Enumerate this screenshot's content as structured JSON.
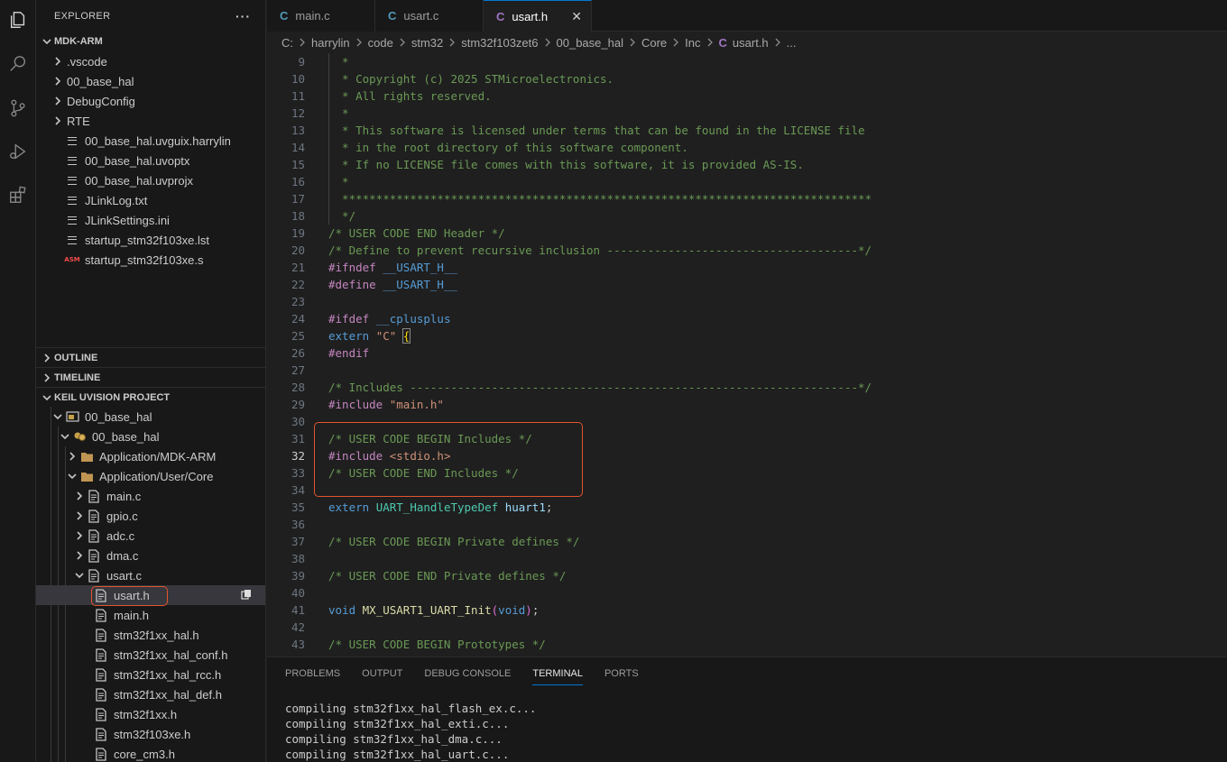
{
  "activity_bar": {
    "icons": [
      "explorer-icon",
      "search-icon",
      "source-control-icon",
      "run-debug-icon",
      "extensions-icon"
    ]
  },
  "explorer": {
    "title": "EXPLORER",
    "more_actions": "···",
    "root_folder": "MDK-ARM",
    "items": [
      ".vscode",
      "00_base_hal",
      "DebugConfig",
      "RTE",
      "00_base_hal.uvguix.harrylin",
      "00_base_hal.uvoptx",
      "00_base_hal.uvprojx",
      "JLinkLog.txt",
      "JLinkSettings.ini",
      "startup_stm32f103xe.lst",
      "startup_stm32f103xe.s"
    ],
    "asm_badge": "ASM",
    "outline": "OUTLINE",
    "timeline": "TIMELINE",
    "keil": {
      "title": "KEIL UVISION PROJECT",
      "project": "00_base_hal",
      "target": "00_base_hal",
      "groups": [
        "Application/MDK-ARM",
        "Application/User/Core"
      ],
      "files": [
        "main.c",
        "gpio.c",
        "adc.c",
        "dma.c",
        "usart.c"
      ],
      "headers": [
        "usart.h",
        "main.h",
        "stm32f1xx_hal.h",
        "stm32f1xx_hal_conf.h",
        "stm32f1xx_hal_rcc.h",
        "stm32f1xx_hal_def.h",
        "stm32f1xx.h",
        "stm32f103xe.h",
        "core_cm3.h"
      ],
      "selected": "usart.h"
    }
  },
  "tabs": [
    {
      "icon": "C",
      "label": "main.c"
    },
    {
      "icon": "C",
      "label": "usart.c"
    },
    {
      "icon": "C",
      "label": "usart.h",
      "active": true
    }
  ],
  "close_glyph": "✕",
  "breadcrumb": [
    "C:",
    "harrylin",
    "code",
    "stm32",
    "stm32f103zet6",
    "00_base_hal",
    "Core",
    "Inc",
    "usart.h",
    "..."
  ],
  "editor": {
    "current_line": 32,
    "lines": [
      {
        "n": 9,
        "t": "  *"
      },
      {
        "n": 10,
        "t": "  * Copyright (c) 2025 STMicroelectronics."
      },
      {
        "n": 11,
        "t": "  * All rights reserved."
      },
      {
        "n": 12,
        "t": "  *"
      },
      {
        "n": 13,
        "t": "  * This software is licensed under terms that can be found in the LICENSE file"
      },
      {
        "n": 14,
        "t": "  * in the root directory of this software component."
      },
      {
        "n": 15,
        "t": "  * If no LICENSE file comes with this software, it is provided AS-IS."
      },
      {
        "n": 16,
        "t": "  *"
      },
      {
        "n": 17,
        "t": "  ******************************************************************************"
      },
      {
        "n": 18,
        "t": "  */"
      },
      {
        "n": 19,
        "t": "/* USER CODE END Header */"
      },
      {
        "n": 20,
        "t": "/* Define to prevent recursive inclusion -------------------------------------*/"
      },
      {
        "n": 21,
        "t": "#ifndef __USART_H__"
      },
      {
        "n": 22,
        "t": "#define __USART_H__"
      },
      {
        "n": 23,
        "t": ""
      },
      {
        "n": 24,
        "t": "#ifdef __cplusplus"
      },
      {
        "n": 25,
        "t": "extern \"C\" {"
      },
      {
        "n": 26,
        "t": "#endif"
      },
      {
        "n": 27,
        "t": ""
      },
      {
        "n": 28,
        "t": "/* Includes ------------------------------------------------------------------*/"
      },
      {
        "n": 29,
        "t": "#include \"main.h\""
      },
      {
        "n": 30,
        "t": ""
      },
      {
        "n": 31,
        "t": "/* USER CODE BEGIN Includes */"
      },
      {
        "n": 32,
        "t": "#include <stdio.h>"
      },
      {
        "n": 33,
        "t": "/* USER CODE END Includes */"
      },
      {
        "n": 34,
        "t": ""
      },
      {
        "n": 35,
        "t": "extern UART_HandleTypeDef huart1;"
      },
      {
        "n": 36,
        "t": ""
      },
      {
        "n": 37,
        "t": "/* USER CODE BEGIN Private defines */"
      },
      {
        "n": 38,
        "t": ""
      },
      {
        "n": 39,
        "t": "/* USER CODE END Private defines */"
      },
      {
        "n": 40,
        "t": ""
      },
      {
        "n": 41,
        "t": "void MX_USART1_UART_Init(void);"
      },
      {
        "n": 42,
        "t": ""
      },
      {
        "n": 43,
        "t": "/* USER CODE BEGIN Prototypes */"
      }
    ]
  },
  "panel": {
    "tabs": [
      "PROBLEMS",
      "OUTPUT",
      "DEBUG CONSOLE",
      "TERMINAL",
      "PORTS"
    ],
    "active_tab": "TERMINAL",
    "terminal_lines": [
      "compiling stm32f1xx_hal_flash_ex.c...",
      "compiling stm32f1xx_hal_exti.c...",
      "compiling stm32f1xx_hal_dma.c...",
      "compiling stm32f1xx_hal_uart.c..."
    ]
  },
  "colors": {
    "comment": "#6a9955",
    "keyword": "#569cd6",
    "preproc": "#c586c0",
    "string": "#ce9178",
    "type": "#4ec9b0",
    "func": "#dcdcaa",
    "macro": "#569cd6",
    "highlight_box": "#e0552e",
    "c_icon": "#519aba",
    "h_icon": "#a074c4"
  }
}
